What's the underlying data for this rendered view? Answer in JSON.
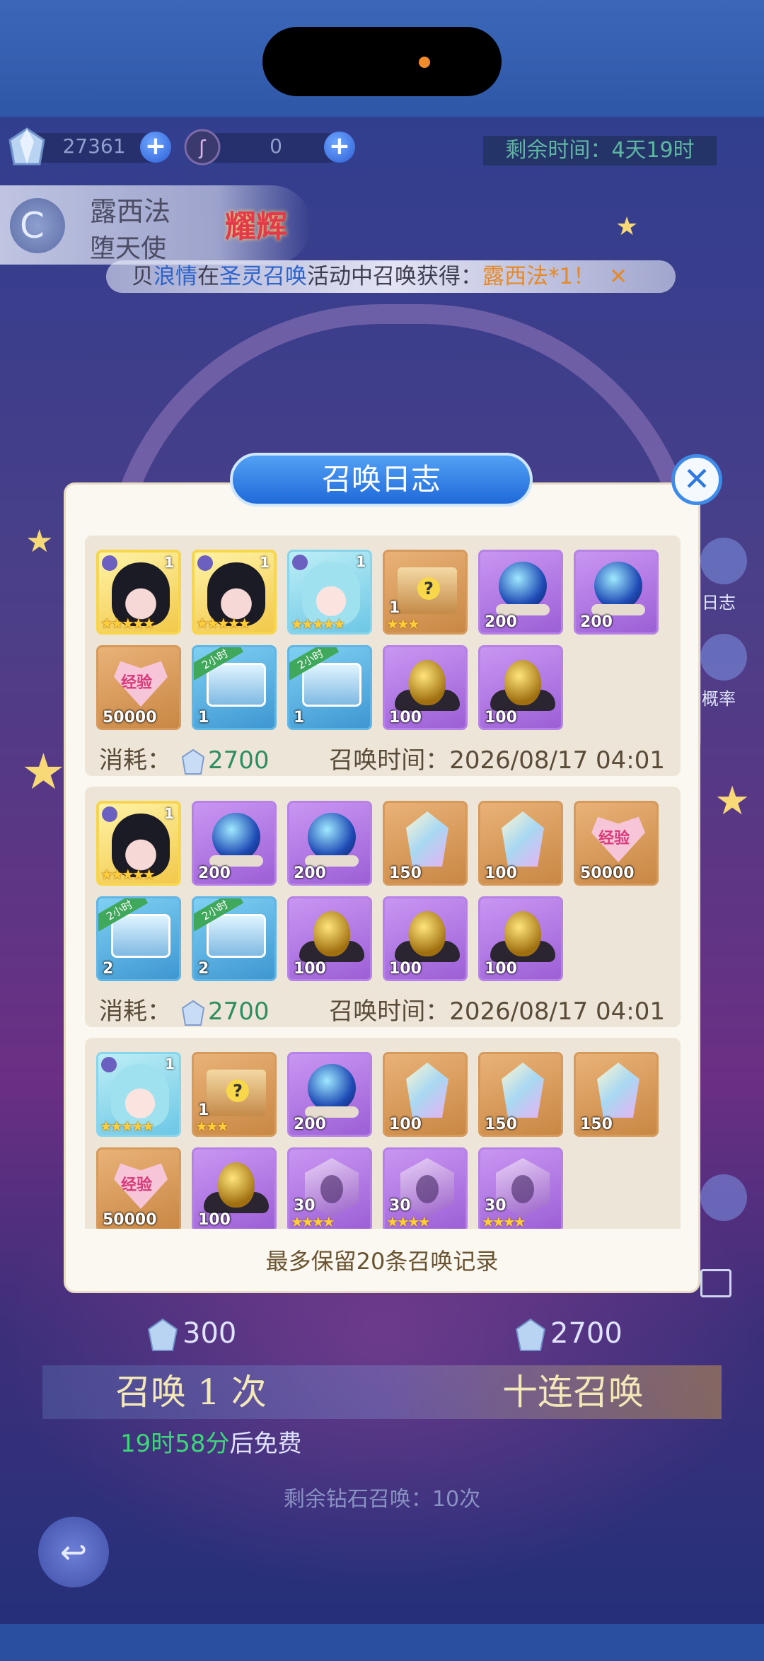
{
  "currencies": [
    {
      "name": "diamond",
      "value": "27361"
    },
    {
      "name": "token",
      "value": "0"
    }
  ],
  "timer": "剩余时间：4天19时",
  "hero": {
    "name": "露西法",
    "title": "堕天使",
    "badge": "耀辉"
  },
  "marquee": {
    "prefix": "贝",
    "player": "浪情",
    "text1": "在",
    "event": "圣灵召唤",
    "text2": "活动中召唤获得：",
    "reward": "露西法*1",
    "text3": "！"
  },
  "side": {
    "log_label": "日志",
    "rate_label": "概率"
  },
  "dialog": {
    "title": "召唤日志",
    "footer": "最多保留20条召唤记录",
    "cost_label": "消耗：",
    "time_label": "召唤时间：",
    "records": [
      {
        "cost": "2700",
        "time": "2026/08/17 04:01",
        "items": [
          {
            "type": "hero-dark",
            "qty": "1",
            "stars": "★★★★★"
          },
          {
            "type": "hero-dark",
            "qty": "1",
            "stars": "★★★★★"
          },
          {
            "type": "hero-light",
            "qty": "1",
            "stars": "★★★★★"
          },
          {
            "type": "mystery-box",
            "qty": "1",
            "stars": "★★★"
          },
          {
            "type": "crystal-orb",
            "qty": "200"
          },
          {
            "type": "crystal-orb",
            "qty": "200"
          },
          {
            "type": "exp-heart",
            "qty": "50000"
          },
          {
            "type": "chest",
            "qty": "1",
            "ribbon": "2小时"
          },
          {
            "type": "chest",
            "qty": "1",
            "ribbon": "2小时"
          },
          {
            "type": "golden-egg",
            "qty": "100"
          },
          {
            "type": "golden-egg",
            "qty": "100"
          }
        ]
      },
      {
        "cost": "2700",
        "time": "2026/08/17 04:01",
        "items": [
          {
            "type": "hero-dark",
            "qty": "1",
            "stars": "★★★★★"
          },
          {
            "type": "crystal-orb",
            "qty": "200"
          },
          {
            "type": "crystal-orb",
            "qty": "200"
          },
          {
            "type": "diamond",
            "qty": "150"
          },
          {
            "type": "diamond",
            "qty": "100"
          },
          {
            "type": "exp-heart",
            "qty": "50000"
          },
          {
            "type": "chest-gold",
            "qty": "2",
            "ribbon": "2小时"
          },
          {
            "type": "chest-gold",
            "qty": "2",
            "ribbon": "2小时"
          },
          {
            "type": "golden-egg",
            "qty": "100"
          },
          {
            "type": "golden-egg",
            "qty": "100"
          },
          {
            "type": "golden-egg",
            "qty": "100"
          }
        ]
      },
      {
        "items": [
          {
            "type": "hero-light",
            "qty": "1",
            "stars": "★★★★★"
          },
          {
            "type": "mystery-box",
            "qty": "1",
            "stars": "★★★"
          },
          {
            "type": "crystal-orb",
            "qty": "200"
          },
          {
            "type": "diamond",
            "qty": "100"
          },
          {
            "type": "diamond",
            "qty": "150"
          },
          {
            "type": "diamond",
            "qty": "150"
          },
          {
            "type": "exp-heart",
            "qty": "50000"
          },
          {
            "type": "golden-egg",
            "qty": "100"
          },
          {
            "type": "shard",
            "qty": "30",
            "stars": "★★★★"
          },
          {
            "type": "shard",
            "qty": "30",
            "stars": "★★★★"
          },
          {
            "type": "shard",
            "qty": "30",
            "stars": "★★★★"
          }
        ]
      }
    ]
  },
  "summon": {
    "single_cost": "300",
    "ten_cost": "2700",
    "single_label": "召唤 1 次",
    "ten_label": "十连召唤",
    "free_time": "19时58分",
    "free_suffix": "后免费",
    "remaining_prefix": "剩余钻石召唤：",
    "remaining_count": "10",
    "remaining_suffix": "次"
  },
  "colors": {
    "accent": "#2f78dd",
    "cost_green": "#2e8c61",
    "panel": "#fbf8f1"
  }
}
